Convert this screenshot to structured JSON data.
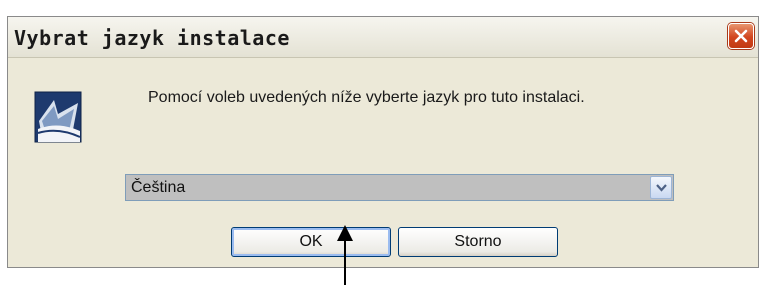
{
  "window": {
    "title": "Vybrat jazyk instalace",
    "close_icon": "close-icon",
    "close_color": "#d2461f"
  },
  "body": {
    "icon": "setup-icon",
    "message": "Pomocí voleb uvedených níže vyberte jazyk pro tuto instalaci."
  },
  "language_select": {
    "selected": "Čeština",
    "dropdown_icon": "chevron-down-icon"
  },
  "buttons": {
    "ok_label": "OK",
    "cancel_label": "Storno"
  },
  "annotation": {
    "icon": "arrow-up-icon",
    "color": "#000000"
  }
}
